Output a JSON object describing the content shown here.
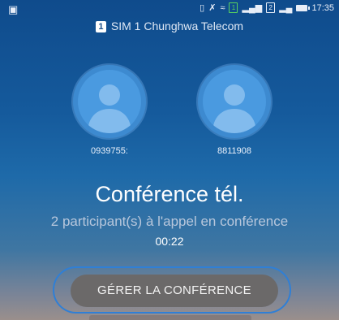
{
  "status_bar": {
    "sim1_label": "1",
    "sim2_label": "2",
    "time": "17:35"
  },
  "carrier": {
    "sim_badge": "1",
    "label": "SIM 1  Chunghwa Telecom"
  },
  "participants": [
    {
      "number": "0939755:"
    },
    {
      "number": "8811908"
    }
  ],
  "conference": {
    "title": "Conférence tél.",
    "subtitle": "2 participant(s) à l'appel en conférence",
    "timer": "00:22"
  },
  "actions": {
    "manage_label": "GÉRER LA CONFÉRENCE"
  },
  "colors": {
    "avatar": "#4a9ae0",
    "button": "#6b6969",
    "outline": "#2f7fd6"
  }
}
